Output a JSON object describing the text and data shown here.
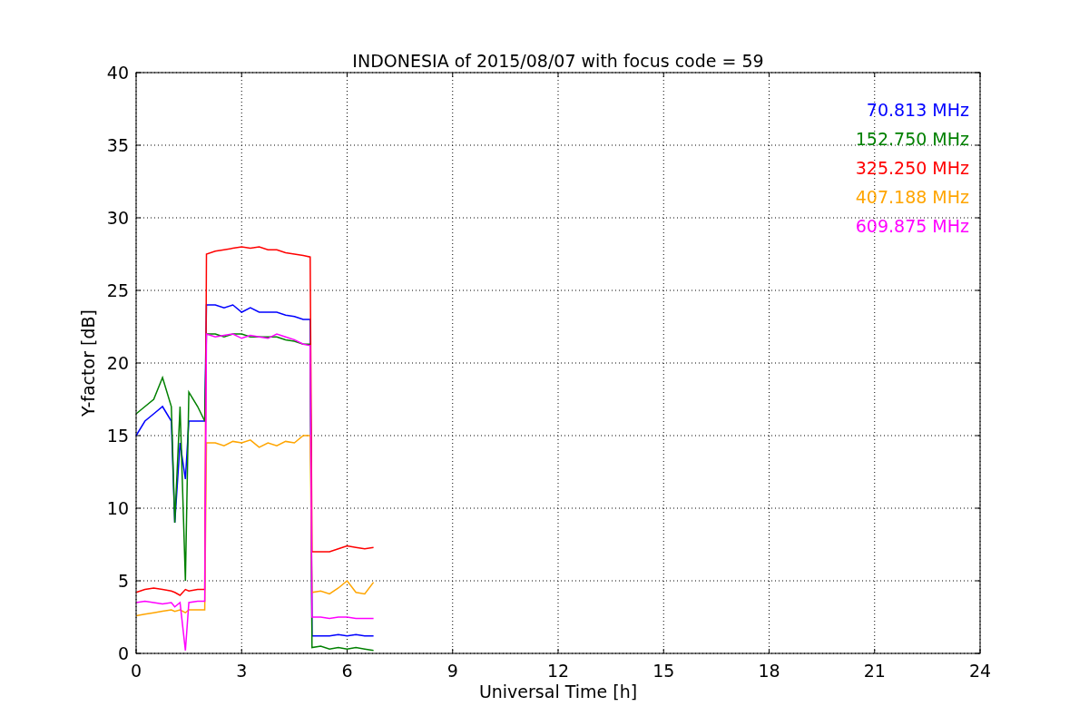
{
  "chart_data": {
    "type": "line",
    "title": "INDONESIA of 2015/08/07 with focus code = 59",
    "xlabel": "Universal Time [h]",
    "ylabel": "Y-factor [dB]",
    "x": [
      0,
      0.25,
      0.5,
      0.75,
      1,
      1.1,
      1.25,
      1.4,
      1.5,
      1.75,
      1.95,
      2,
      2.25,
      2.5,
      2.75,
      3,
      3.25,
      3.5,
      3.75,
      4,
      4.25,
      4.5,
      4.75,
      4.95,
      5,
      5.25,
      5.5,
      5.75,
      6,
      6.25,
      6.5,
      6.75
    ],
    "series": [
      {
        "name": "70.813 MHz",
        "color": "#0000ff",
        "values": [
          15,
          16,
          16.5,
          17,
          16,
          9,
          14.5,
          12,
          16,
          16,
          16,
          24,
          24,
          23.8,
          24,
          23.5,
          23.8,
          23.5,
          23.5,
          23.5,
          23.3,
          23.2,
          23,
          23,
          1.2,
          1.2,
          1.2,
          1.3,
          1.2,
          1.3,
          1.2,
          1.2
        ]
      },
      {
        "name": "152.750 MHz",
        "color": "#008000",
        "values": [
          16.5,
          17,
          17.5,
          19,
          17,
          9,
          17,
          5,
          18,
          17,
          16,
          22,
          22,
          21.8,
          22,
          22,
          21.8,
          21.8,
          21.8,
          21.8,
          21.6,
          21.5,
          21.3,
          21.3,
          0.4,
          0.5,
          0.3,
          0.4,
          0.3,
          0.4,
          0.3,
          0.2
        ]
      },
      {
        "name": "325.250 MHz",
        "color": "#ff0000",
        "values": [
          4.2,
          4.4,
          4.5,
          4.4,
          4.3,
          4.2,
          4,
          4.4,
          4.3,
          4.4,
          4.4,
          27.5,
          27.7,
          27.8,
          27.9,
          28,
          27.9,
          28,
          27.8,
          27.8,
          27.6,
          27.5,
          27.4,
          27.3,
          7,
          7,
          7,
          7.2,
          7.4,
          7.3,
          7.2,
          7.3
        ]
      },
      {
        "name": "407.188 MHz",
        "color": "#ffa500",
        "values": [
          2.6,
          2.7,
          2.8,
          2.9,
          3,
          2.9,
          3,
          2.8,
          3,
          3,
          3,
          14.5,
          14.5,
          14.3,
          14.6,
          14.5,
          14.7,
          14.2,
          14.5,
          14.3,
          14.6,
          14.5,
          15,
          15,
          4.2,
          4.3,
          4.1,
          4.5,
          5,
          4.2,
          4.1,
          4.9
        ]
      },
      {
        "name": "609.875 MHz",
        "color": "#ff00ff",
        "values": [
          3.5,
          3.6,
          3.5,
          3.4,
          3.5,
          3.2,
          3.5,
          0.2,
          3.5,
          3.6,
          3.6,
          22,
          21.8,
          21.9,
          22,
          21.7,
          21.9,
          21.8,
          21.7,
          22,
          21.8,
          21.6,
          21.3,
          21.2,
          2.5,
          2.5,
          2.4,
          2.5,
          2.5,
          2.4,
          2.4,
          2.4
        ]
      }
    ],
    "xlim": [
      0,
      24
    ],
    "ylim": [
      0,
      40
    ],
    "xticks": [
      0,
      3,
      6,
      9,
      12,
      15,
      18,
      21,
      24
    ],
    "yticks": [
      0,
      5,
      10,
      15,
      20,
      25,
      30,
      35,
      40
    ],
    "grid": true
  }
}
